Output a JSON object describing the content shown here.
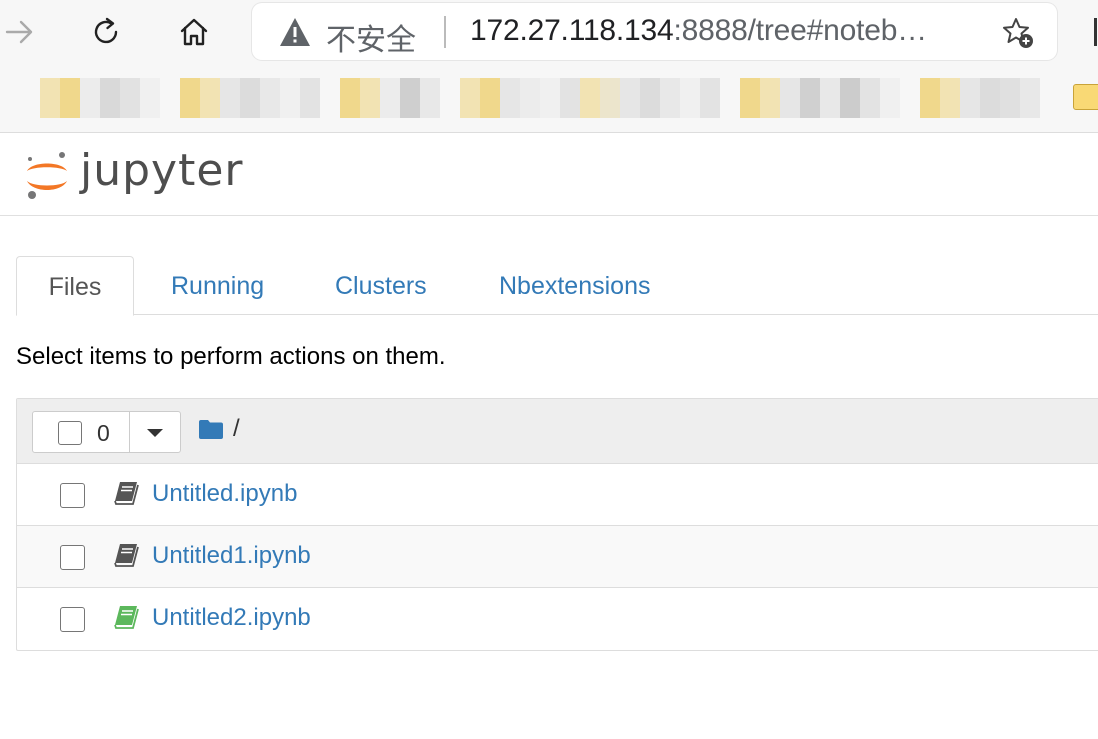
{
  "browser": {
    "security_label": "不安全",
    "url_host": "172.27.118.134",
    "url_rest": ":8888/tree#noteb…",
    "icons": [
      "forward-icon",
      "refresh-icon",
      "home-icon",
      "warning-icon",
      "favorite-add-icon"
    ]
  },
  "jupyter": {
    "logo_text": "jupyter"
  },
  "tabs": [
    {
      "label": "Files",
      "active": true
    },
    {
      "label": "Running",
      "active": false
    },
    {
      "label": "Clusters",
      "active": false
    },
    {
      "label": "Nbextensions",
      "active": false
    }
  ],
  "hint": "Select items to perform actions on them.",
  "list": {
    "selected_count": "0",
    "breadcrumb": "/",
    "files": [
      {
        "name": "Untitled.ipynb",
        "status": "stopped",
        "icon_color": "#555555"
      },
      {
        "name": "Untitled1.ipynb",
        "status": "stopped",
        "icon_color": "#555555"
      },
      {
        "name": "Untitled2.ipynb",
        "status": "running",
        "icon_color": "#5cb85c"
      }
    ]
  },
  "colors": {
    "link": "#337ab7",
    "jupyter_orange": "#f37726",
    "running_green": "#5cb85c"
  }
}
